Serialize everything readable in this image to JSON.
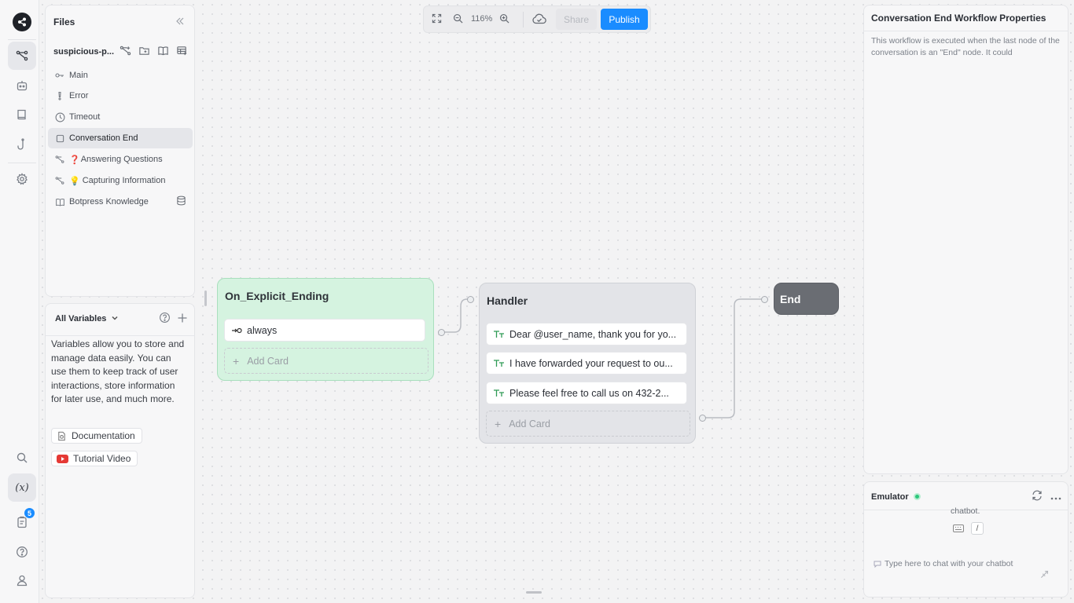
{
  "toolbar": {
    "zoom": "116%",
    "share_label": "Share",
    "publish_label": "Publish",
    "publish_color": "#1a8cff"
  },
  "rail": {
    "icons": [
      "botpress-logo-icon",
      "workflows-icon",
      "agents-icon",
      "knowledge-icon",
      "hooks-icon",
      "settings-icon",
      "search-icon",
      "variables-icon",
      "logs-icon",
      "help-icon",
      "user-icon"
    ],
    "variables_glyph": "(x)",
    "logs_badge": "5"
  },
  "files": {
    "title": "Files",
    "bot_name": "suspicious-p...",
    "items": [
      {
        "label": "Main",
        "icon": "key-icon"
      },
      {
        "label": "Error",
        "icon": "exclamation-icon"
      },
      {
        "label": "Timeout",
        "icon": "clock-icon"
      },
      {
        "label": "Conversation End",
        "icon": "square-icon",
        "selected": true
      },
      {
        "label": "Answering Questions",
        "icon": "workflow-icon",
        "emoji": "❓"
      },
      {
        "label": "Capturing Information",
        "icon": "workflow-icon",
        "emoji": "💡"
      },
      {
        "label": "Botpress Knowledge",
        "icon": "book-icon",
        "trailing_icon": "database-icon"
      }
    ]
  },
  "variables": {
    "title": "All Variables",
    "description": "Variables allow you to store and manage data easily. You can use them to keep track of user interactions, store information for later use, and much more.",
    "links": [
      {
        "label": "Documentation",
        "icon": "docs-icon"
      },
      {
        "label": "Tutorial Video",
        "icon": "youtube-icon"
      }
    ]
  },
  "canvas": {
    "nodes": {
      "entry": {
        "title": "On_Explicit_Ending",
        "color": "#d5f3e0",
        "cards": [
          {
            "label": "always",
            "icon": "arrow-circle-icon"
          }
        ],
        "add_card": "Add Card"
      },
      "handler": {
        "title": "Handler",
        "color": "#e3e4e8",
        "cards": [
          {
            "label": "Dear @user_name, thank you for yo...",
            "icon": "text-icon"
          },
          {
            "label": "I have forwarded your request to ou...",
            "icon": "text-icon"
          },
          {
            "label": "Please feel free to call us on 432-2...",
            "icon": "text-icon"
          }
        ],
        "add_card": "Add Card"
      },
      "end": {
        "title": "End",
        "color": "#6a6d73"
      }
    }
  },
  "properties": {
    "title": "Conversation End Workflow Properties",
    "description": "This workflow is executed when the last node of the conversation is an \"End\" node. It could"
  },
  "emulator": {
    "title": "Emulator",
    "status_color": "#2cc77b",
    "message_fragment": "chatbot.",
    "shortcut_slash": "/",
    "input_placeholder": "Type here to chat with your chatbot"
  }
}
